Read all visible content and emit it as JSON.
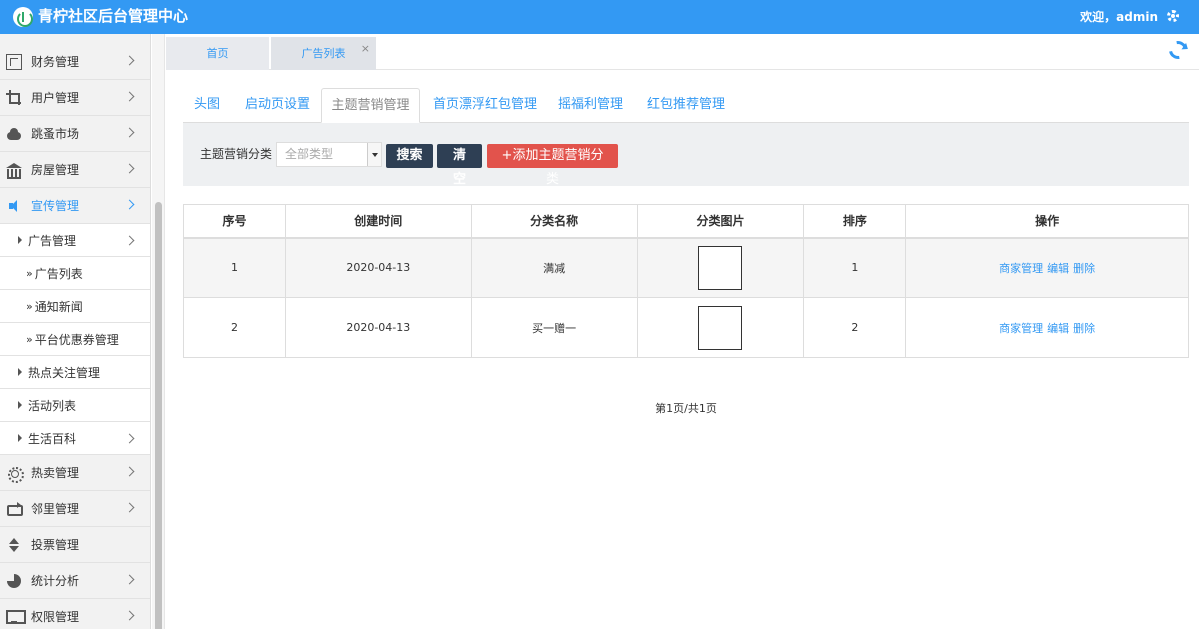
{
  "header": {
    "title": "青柠社区后台管理中心",
    "welcome": "欢迎，admin",
    "bg_color": "#3399f3"
  },
  "sidebar": {
    "items": [
      {
        "label": "财务管理",
        "icon": "grid-icon"
      },
      {
        "label": "用户管理",
        "icon": "crop-icon"
      },
      {
        "label": "跳蚤市场",
        "icon": "cloud-icon"
      },
      {
        "label": "房屋管理",
        "icon": "bank-icon"
      },
      {
        "label": "宣传管理",
        "icon": "speaker-icon",
        "active": true
      },
      {
        "label": "热卖管理",
        "icon": "sun-icon"
      },
      {
        "label": "邻里管理",
        "icon": "retweet-icon"
      },
      {
        "label": "投票管理",
        "icon": "sort-icon"
      },
      {
        "label": "统计分析",
        "icon": "pie-chart-icon"
      },
      {
        "label": "权限管理",
        "icon": "monitor-icon"
      }
    ],
    "sub": {
      "ad": "广告管理",
      "ad_list": "广告列表",
      "news": "通知新闻",
      "coupon": "平台优惠券管理",
      "hot": "热点关注管理",
      "activity": "活动列表",
      "wiki": "生活百科"
    }
  },
  "page_tabs": {
    "home": "首页",
    "current": "广告列表",
    "close": "×"
  },
  "content_tabs": [
    "头图",
    "启动页设置",
    "主题营销管理",
    "首页漂浮红包管理",
    "摇福利管理",
    "红包推荐管理"
  ],
  "search": {
    "label": "主题营销分类",
    "select_value": "全部类型",
    "search_btn": "搜索",
    "clear_btn": "清空",
    "add_btn": "+添加主题营销分类"
  },
  "table": {
    "headers": [
      "序号",
      "创建时间",
      "分类名称",
      "分类图片",
      "排序",
      "操作"
    ],
    "rows": [
      {
        "no": "1",
        "date": "2020-04-13",
        "name": "满减",
        "sort": "1"
      },
      {
        "no": "2",
        "date": "2020-04-13",
        "name": "买一赠一",
        "sort": "2"
      }
    ],
    "ops": [
      "商家管理",
      "编辑",
      "删除"
    ]
  },
  "pager": "第1页/共1页"
}
